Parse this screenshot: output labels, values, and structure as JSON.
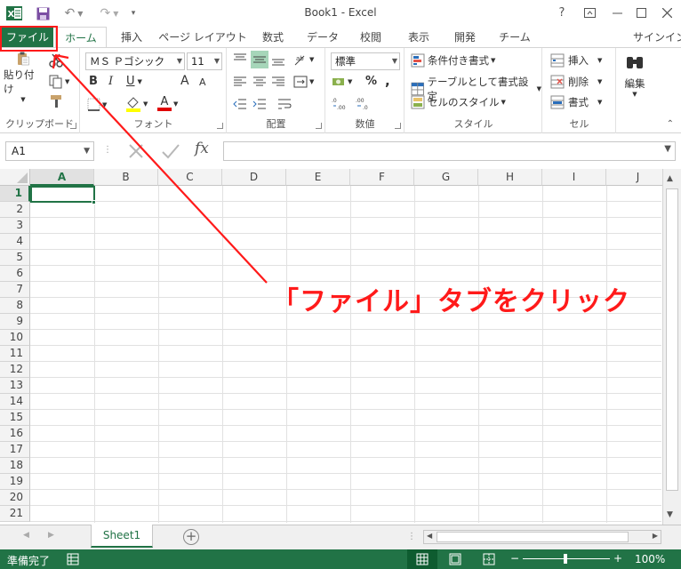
{
  "window": {
    "title": "Book1 - Excel",
    "help": "?",
    "sign_in": "サインイン"
  },
  "tabs": [
    "ファイル",
    "ホーム",
    "挿入",
    "ページ レイアウト",
    "数式",
    "データ",
    "校閲",
    "表示",
    "開発",
    "チーム"
  ],
  "ribbon": {
    "clipboard": {
      "paste_label": "貼り付け",
      "group_label": "クリップボード"
    },
    "font": {
      "font_name": "ＭＳ Ｐゴシック",
      "font_size": "11",
      "bold": "B",
      "italic": "I",
      "underline": "U",
      "grow": "A",
      "shrink": "A",
      "font_color_letter": "A",
      "group_label": "フォント"
    },
    "alignment": {
      "group_label": "配置"
    },
    "number": {
      "format": "標準",
      "percent": "%",
      "comma": ",",
      "group_label": "数値"
    },
    "styles": {
      "conditional": "条件付き書式",
      "table": "テーブルとして書式設定",
      "cell_styles": "セルのスタイル",
      "group_label": "スタイル"
    },
    "cells": {
      "insert": "挿入",
      "delete": "削除",
      "format": "書式",
      "group_label": "セル"
    },
    "editing": {
      "label": "編集"
    }
  },
  "formula_bar": {
    "name_box": "A1",
    "fx": "fx",
    "value": ""
  },
  "columns": [
    "A",
    "B",
    "C",
    "D",
    "E",
    "F",
    "G",
    "H",
    "I",
    "J"
  ],
  "rows": [
    "1",
    "2",
    "3",
    "4",
    "5",
    "6",
    "7",
    "8",
    "9",
    "10",
    "11",
    "12",
    "13",
    "14",
    "15",
    "16",
    "17",
    "18",
    "19",
    "20",
    "21"
  ],
  "active_cell": "A1",
  "sheet_tabs": {
    "sheet1": "Sheet1",
    "add": "+"
  },
  "status_bar": {
    "ready": "準備完了",
    "zoom": "100%",
    "zoom_minus": "−",
    "zoom_plus": "+"
  },
  "annotation": {
    "text": "「ファイル」タブをクリック",
    "color": "#ff1a1a"
  },
  "colors": {
    "accent": "#217346",
    "annotation": "#ff1a1a"
  }
}
